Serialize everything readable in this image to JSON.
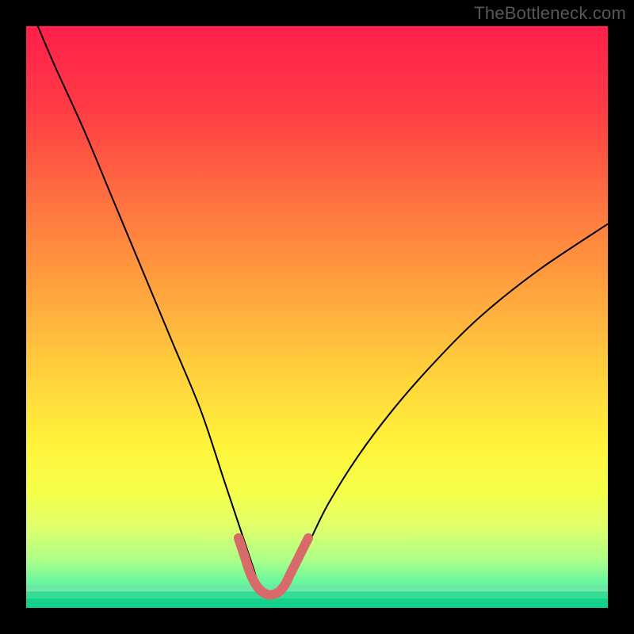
{
  "watermark": "TheBottleneck.com",
  "chart_data": {
    "type": "line",
    "title": "",
    "xlabel": "",
    "ylabel": "",
    "xlim": [
      0,
      100
    ],
    "ylim": [
      0,
      100
    ],
    "grid": false,
    "legend": false,
    "series": [
      {
        "name": "bottleneck-curve",
        "x": [
          2,
          5,
          10,
          15,
          20,
          25,
          30,
          34,
          37,
          39,
          40,
          41,
          42,
          43,
          44,
          45,
          47,
          49,
          52,
          57,
          63,
          70,
          78,
          88,
          100
        ],
        "y": [
          100,
          93,
          82,
          70,
          58,
          46,
          34,
          22,
          13,
          7,
          4,
          2.5,
          2,
          2,
          2.5,
          4,
          8,
          12,
          18,
          26,
          34,
          42,
          50,
          58,
          66
        ],
        "stroke": "#000000",
        "stroke_width": 2
      },
      {
        "name": "optimal-zone-marker",
        "x": [
          36.5,
          37.5,
          38.5,
          39.5,
          40.5,
          41.5,
          42.5,
          43.5,
          44.5,
          45.5,
          46.5,
          47.5,
          48.5
        ],
        "y": [
          12,
          9,
          6,
          4,
          2.8,
          2.3,
          2.3,
          2.8,
          4,
          6,
          8,
          10,
          12
        ],
        "stroke": "#d86a6a",
        "stroke_width": 12,
        "linecap": "round"
      }
    ],
    "background_gradient": {
      "stops": [
        {
          "offset": 0.0,
          "color": "#ff1f4b"
        },
        {
          "offset": 0.14,
          "color": "#ff3b44"
        },
        {
          "offset": 0.3,
          "color": "#ff7140"
        },
        {
          "offset": 0.45,
          "color": "#ffa23e"
        },
        {
          "offset": 0.6,
          "color": "#ffd23c"
        },
        {
          "offset": 0.72,
          "color": "#fff33a"
        },
        {
          "offset": 0.8,
          "color": "#f6ff4a"
        },
        {
          "offset": 0.86,
          "color": "#e0ff6a"
        },
        {
          "offset": 0.92,
          "color": "#aaff8a"
        },
        {
          "offset": 0.96,
          "color": "#60f7a0"
        },
        {
          "offset": 1.0,
          "color": "#17e890"
        }
      ]
    },
    "green_bands": [
      {
        "y0": 0.96,
        "y1": 0.972,
        "color": "#6de9a5"
      },
      {
        "y0": 0.972,
        "y1": 0.984,
        "color": "#35dc96"
      },
      {
        "y0": 0.984,
        "y1": 1.0,
        "color": "#14d18b"
      }
    ]
  }
}
